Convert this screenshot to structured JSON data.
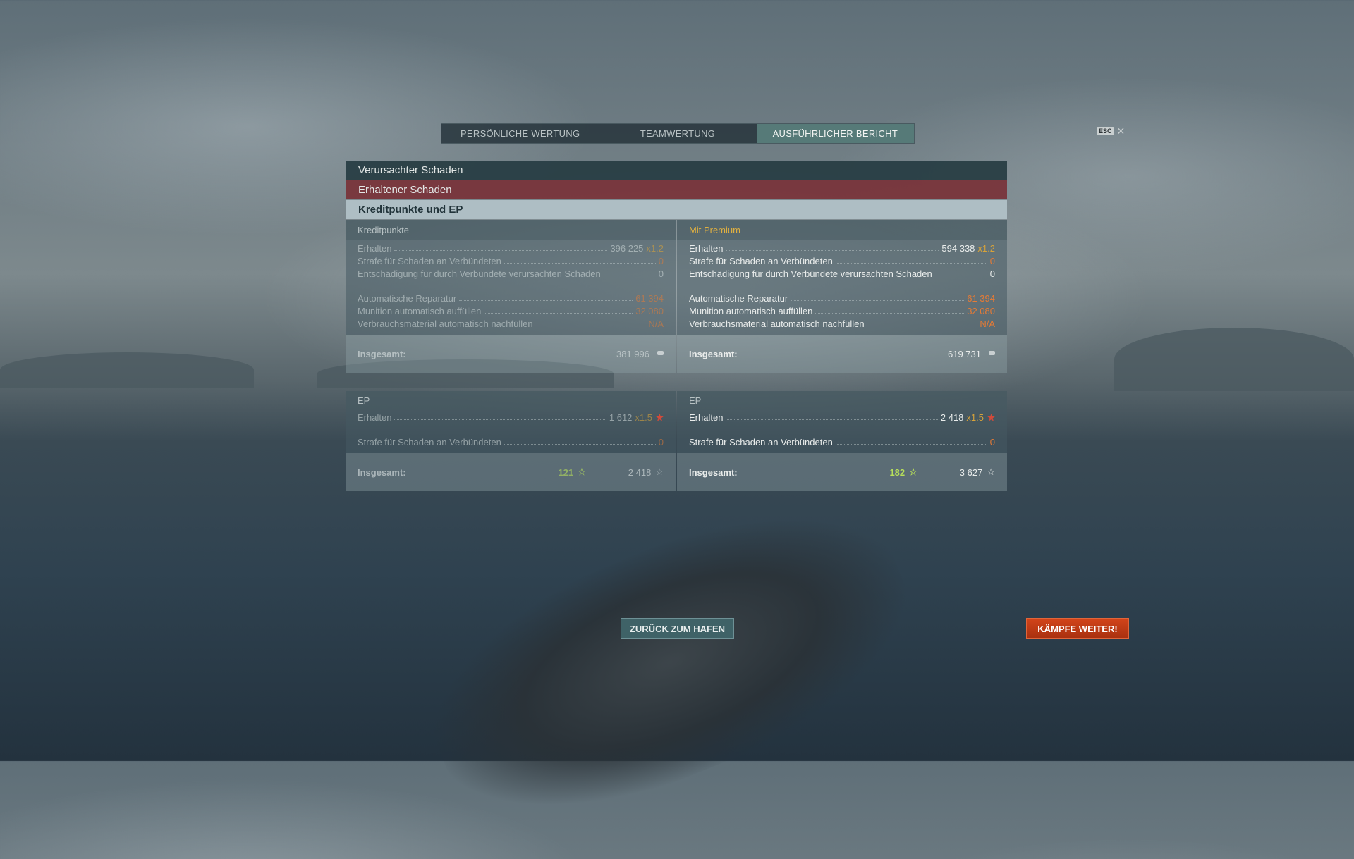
{
  "tabs": [
    {
      "label": "PERSÖNLICHE WERTUNG",
      "active": false
    },
    {
      "label": "TEAMWERTUNG",
      "active": false
    },
    {
      "label": "AUSFÜHRLICHER BERICHT",
      "active": true
    }
  ],
  "esc": {
    "key": "ESC",
    "close": "✕"
  },
  "sections": {
    "dealt": "Verursachter Schaden",
    "received": "Erhaltener Schaden",
    "credits_ep": "Kreditpunkte und EP"
  },
  "credits": {
    "base": {
      "header": "Kreditpunkte",
      "rows": [
        {
          "label": "Erhalten",
          "value": "396 225",
          "mult": "x1.2"
        },
        {
          "label": "Strafe für Schaden an Verbündeten",
          "value": "0"
        },
        {
          "label": "Entschädigung für durch Verbündete verursachten Schaden",
          "value": "0"
        },
        {
          "label": "Automatische Reparatur",
          "value": "61 394"
        },
        {
          "label": "Munition automatisch auffüllen",
          "value": "32 080"
        },
        {
          "label": "Verbrauchsmaterial automatisch nachfüllen",
          "value": "N/A"
        }
      ],
      "total_label": "Insgesamt:",
      "total_value": "381 996"
    },
    "premium": {
      "header": "Mit Premium",
      "rows": [
        {
          "label": "Erhalten",
          "value": "594 338",
          "mult": "x1.2"
        },
        {
          "label": "Strafe für Schaden an Verbündeten",
          "value": "0"
        },
        {
          "label": "Entschädigung für durch Verbündete verursachten Schaden",
          "value": "0"
        },
        {
          "label": "Automatische Reparatur",
          "value": "61 394"
        },
        {
          "label": "Munition automatisch auffüllen",
          "value": "32 080"
        },
        {
          "label": "Verbrauchsmaterial automatisch nachfüllen",
          "value": "N/A"
        }
      ],
      "total_label": "Insgesamt:",
      "total_value": "619 731"
    }
  },
  "ep": {
    "base": {
      "header": "EP",
      "rows": [
        {
          "label": "Erhalten",
          "value": "1 612",
          "mult": "x1.5"
        },
        {
          "label": "Strafe für Schaden an Verbündeten",
          "value": "0"
        }
      ],
      "total_label": "Insgesamt:",
      "total_free": "121",
      "total_value": "2 418"
    },
    "premium": {
      "header": "EP",
      "rows": [
        {
          "label": "Erhalten",
          "value": "2 418",
          "mult": "x1.5"
        },
        {
          "label": "Strafe für Schaden an Verbündeten",
          "value": "0"
        }
      ],
      "total_label": "Insgesamt:",
      "total_free": "182",
      "total_value": "3 627"
    }
  },
  "buttons": {
    "port": "ZURÜCK ZUM HAFEN",
    "fight": "KÄMPFE WEITER!"
  },
  "icons": {
    "star": "☆"
  },
  "colors": {
    "accent_tab": "#567a78",
    "premium": "#e0b040",
    "negative": "#e67b35",
    "fight": "#d2441a",
    "free_xp": "#b7e05a"
  }
}
